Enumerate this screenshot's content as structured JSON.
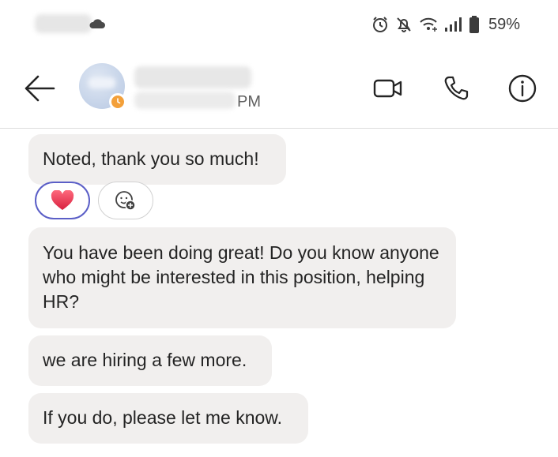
{
  "status_bar": {
    "battery": "59%",
    "icons": [
      "cloud-icon",
      "alarm-icon",
      "notifications-off-icon",
      "wifi-icon",
      "signal-icon",
      "battery-icon"
    ]
  },
  "header": {
    "last_seen": "PM",
    "icons": [
      "back-arrow-icon",
      "video-call-icon",
      "phone-call-icon",
      "info-icon"
    ],
    "presence_color": "#f3a03a"
  },
  "messages": [
    {
      "text": "Noted, thank you so much!"
    },
    {
      "text": "You have been doing great! Do you know anyone who might be interested in this position, helping HR?"
    },
    {
      "text": "we are hiring a few more."
    },
    {
      "text": "If you do, please let me know."
    }
  ],
  "reactions": {
    "selected": "heart",
    "selected_border": "#5b5fc7",
    "icons": [
      "heart-icon",
      "add-reaction-icon"
    ]
  }
}
